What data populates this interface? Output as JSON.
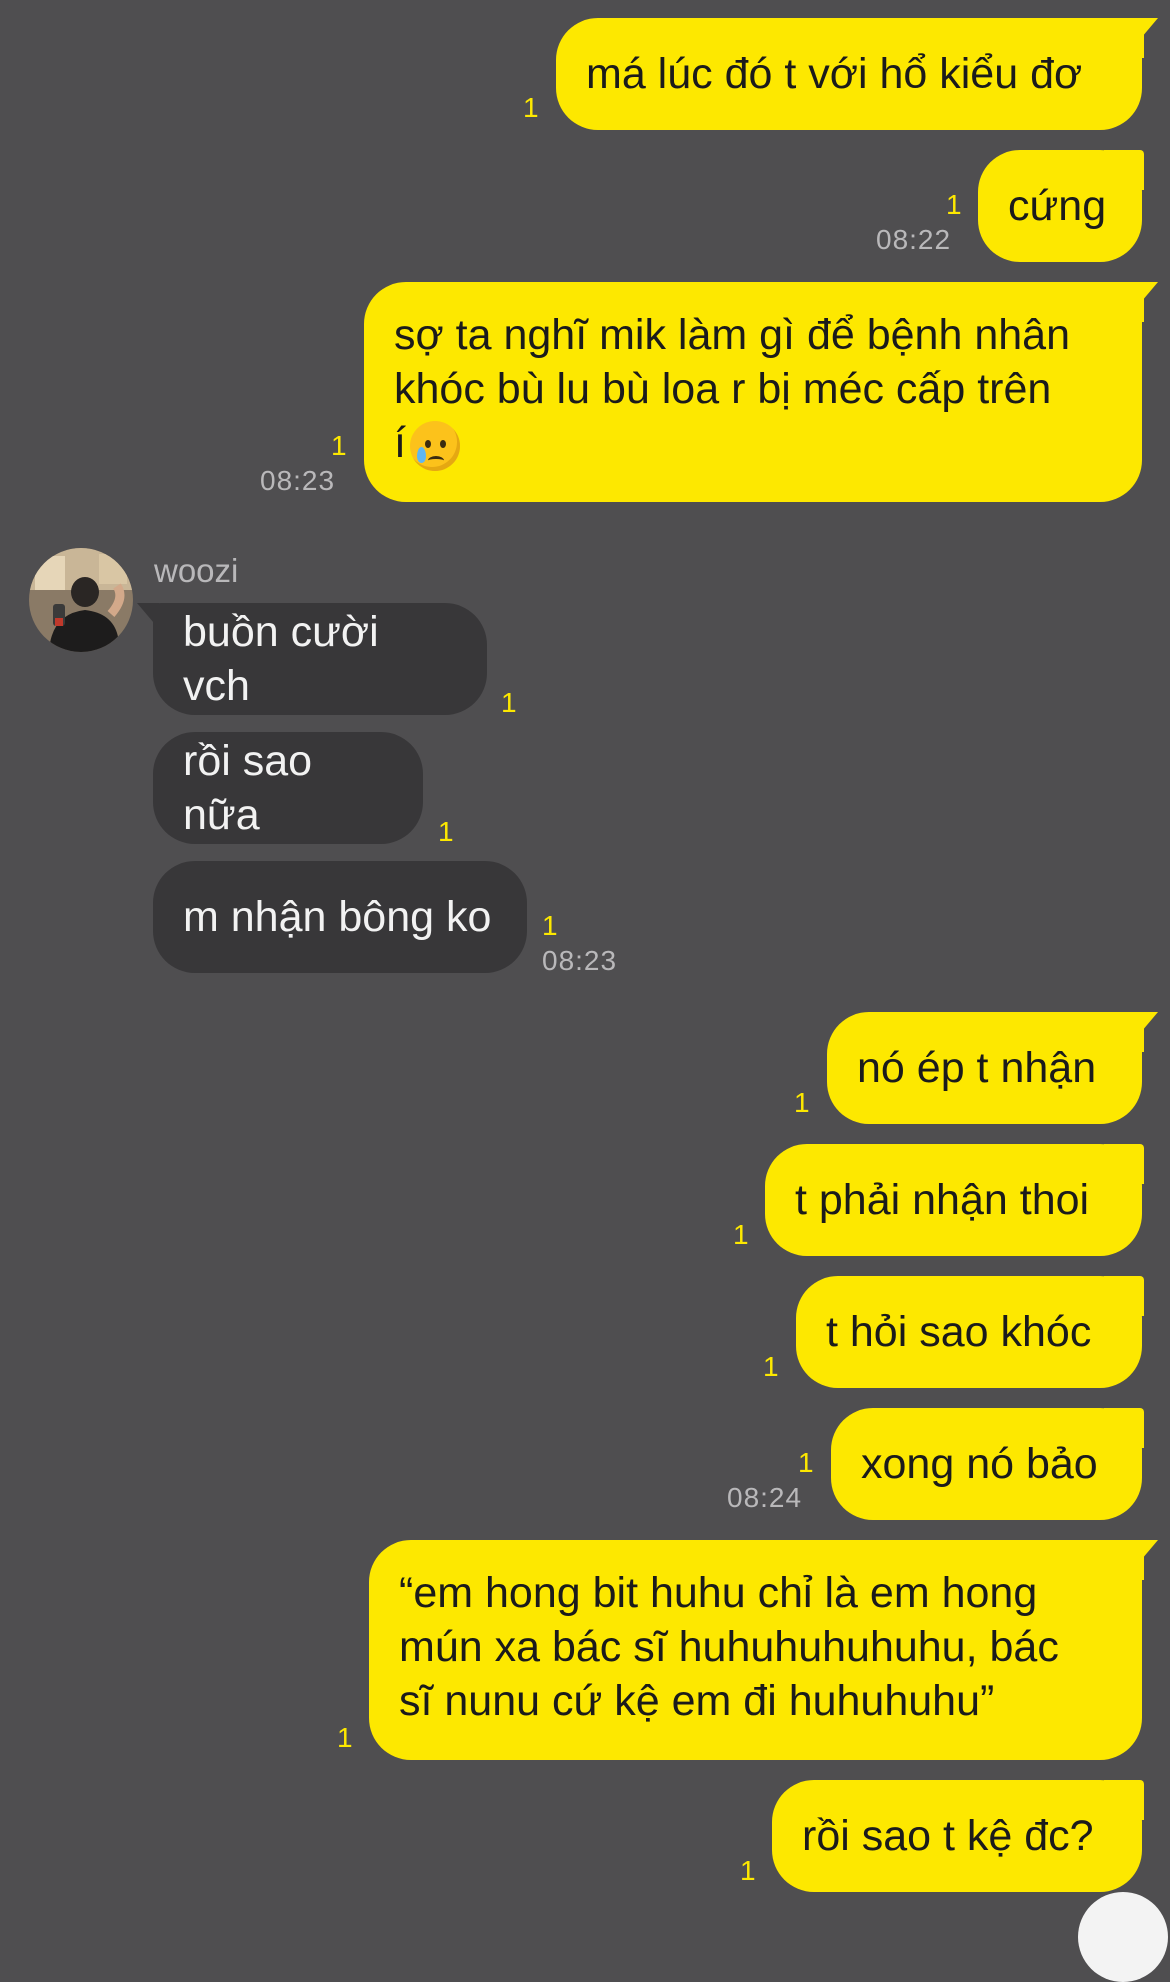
{
  "chat": {
    "contact_name": "woozi",
    "messages": [
      {
        "text": "má lúc đó t với hổ kiểu đơ",
        "read": "1",
        "time": ""
      },
      {
        "text": "cứng",
        "read": "1",
        "time": "08:22"
      },
      {
        "text": "sợ ta nghĩ mik làm gì để bệnh nhân\nkhóc bù lu bù loa r bị méc cấp trên\ní",
        "read": "1",
        "time": "08:23",
        "emoji": "crying-face"
      },
      {
        "text": "buồn cười vch",
        "read": "1",
        "time": ""
      },
      {
        "text": "rồi sao nữa",
        "read": "1",
        "time": ""
      },
      {
        "text": "m nhận bông ko",
        "read": "1",
        "time": "08:23"
      },
      {
        "text": "nó ép t nhận",
        "read": "1",
        "time": ""
      },
      {
        "text": "t phải nhận thoi",
        "read": "1",
        "time": ""
      },
      {
        "text": "t hỏi sao khóc",
        "read": "1",
        "time": ""
      },
      {
        "text": "xong nó bảo",
        "read": "1",
        "time": "08:24"
      },
      {
        "text": "“em hong bit huhu chỉ là em hong\nmún xa bác sĩ huhuhuhuhuhu, bác\nsĩ nunu cứ kệ em đi huhuhuhu”",
        "read": "1",
        "time": ""
      },
      {
        "text": "rồi sao t kệ đc?",
        "read": "1",
        "time": ""
      }
    ]
  },
  "colors": {
    "background": "#4f4e50",
    "outgoing_bubble": "#fde800",
    "incoming_bubble": "#383739",
    "unread_counter": "#fde800"
  }
}
